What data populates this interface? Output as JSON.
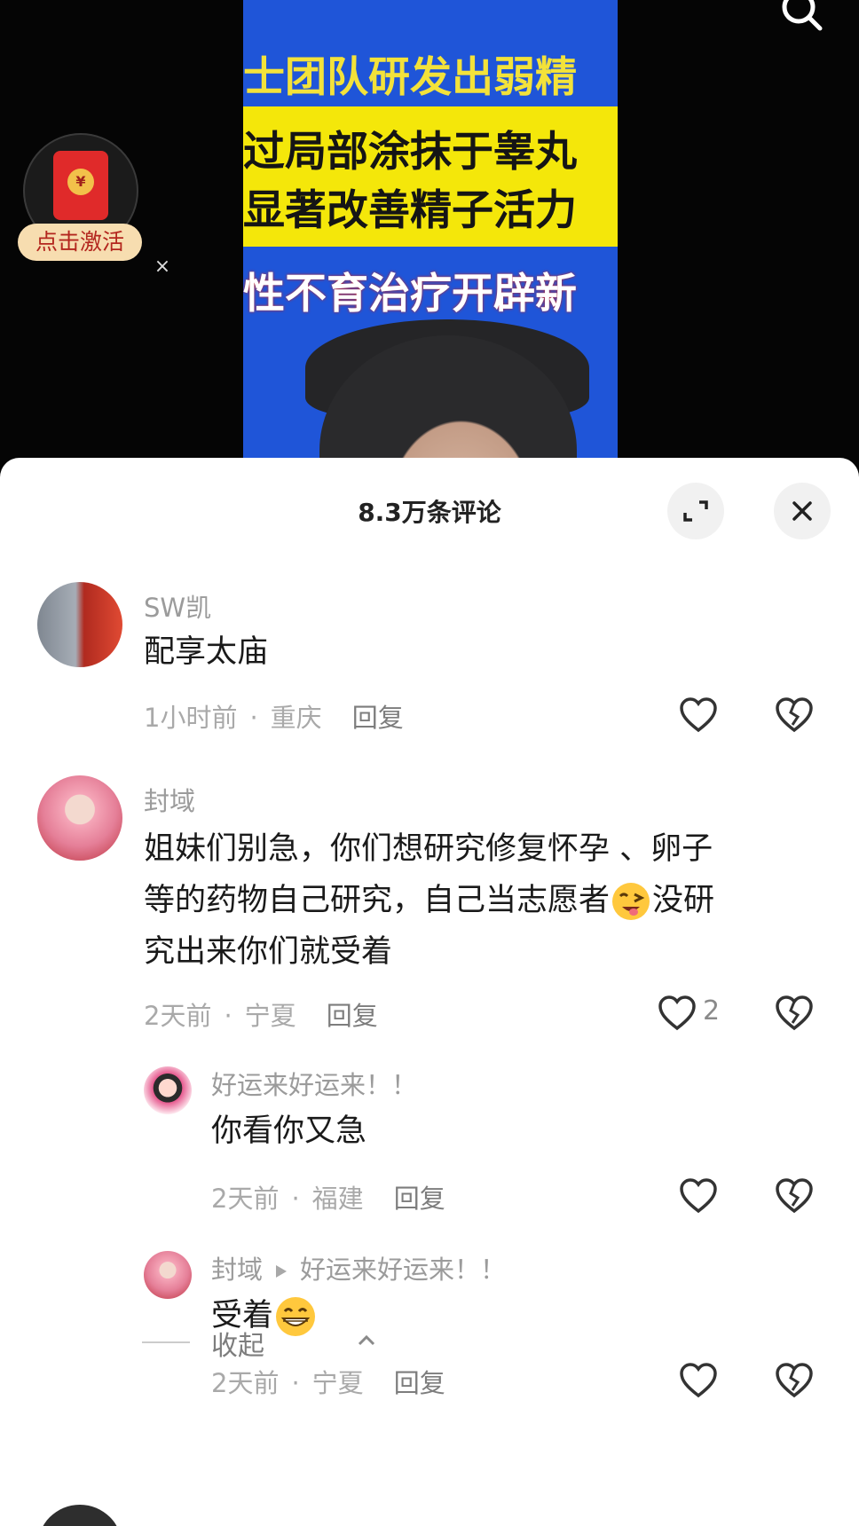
{
  "video": {
    "captions": [
      "士团队研发出弱精",
      "过局部涂抹于睾丸",
      "显著改善精子活力",
      "性不育治疗开辟新"
    ]
  },
  "red_packet": {
    "label": "点击激活"
  },
  "comments_panel": {
    "title": "8.3万条评论"
  },
  "comments": [
    {
      "user": "SW凯",
      "text": "配享太庙",
      "time": "1小时前",
      "location": "重庆",
      "reply_label": "回复",
      "likes": ""
    },
    {
      "user": "封域",
      "text_parts": [
        "姐妹们别急，你们想研究修复怀孕 、卵子",
        "等的药物自己研究，自己当志愿者",
        "没研",
        "究出来你们就受着"
      ],
      "emoji": "winking-face-with-tongue",
      "time": "2天前",
      "location": "宁夏",
      "reply_label": "回复",
      "likes": "2"
    }
  ],
  "replies": [
    {
      "user": "好运来好运来！！",
      "text": "你看你又急",
      "time": "2天前",
      "location": "福建",
      "reply_label": "回复"
    },
    {
      "user": "封域",
      "reply_to": "好运来好运来！！",
      "text": "受着",
      "emoji": "grinning-face",
      "time": "2天前",
      "location": "宁夏",
      "reply_label": "回复"
    }
  ],
  "collapse_label": "收起",
  "colors": {
    "sheet_bg": "#ffffff",
    "caption_yellow": "#f4e70a",
    "caption_blue": "#1f55d8",
    "red_packet_label_bg": "#f7ddb0"
  }
}
